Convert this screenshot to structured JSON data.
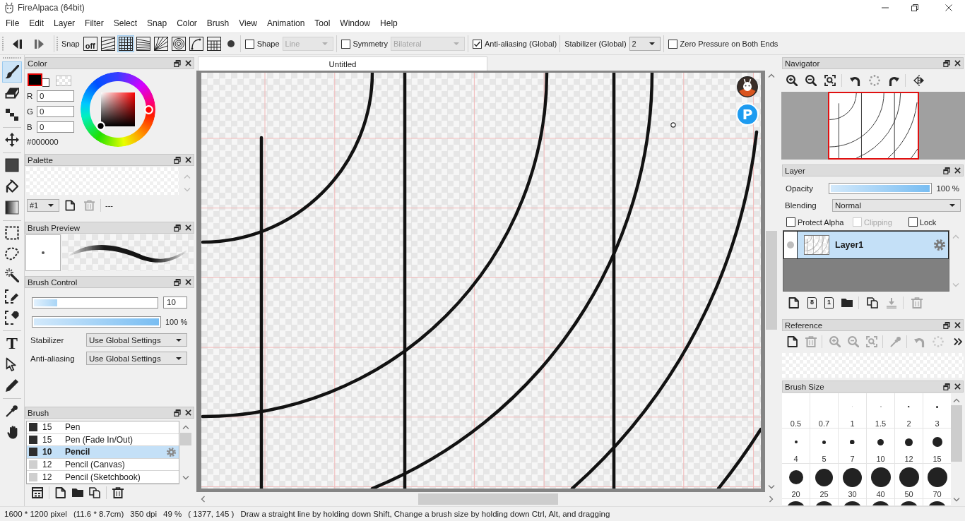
{
  "window": {
    "title": "FireAlpaca (64bit)"
  },
  "menu": [
    "File",
    "Edit",
    "Layer",
    "Filter",
    "Select",
    "Snap",
    "Color",
    "Brush",
    "View",
    "Animation",
    "Tool",
    "Window",
    "Help"
  ],
  "toolbar": {
    "snap_label": "Snap",
    "snap_modes": [
      {
        "kind": "off",
        "label": "off",
        "selected": false
      },
      {
        "kind": "parallel",
        "selected": false
      },
      {
        "kind": "grid",
        "selected": true
      },
      {
        "kind": "converging",
        "selected": false
      },
      {
        "kind": "radial",
        "selected": false
      },
      {
        "kind": "concentric",
        "selected": false
      },
      {
        "kind": "curve",
        "selected": false
      },
      {
        "kind": "perspective",
        "selected": false
      }
    ],
    "options": [
      {
        "kind": "checkbox-dropdown",
        "label": "Shape",
        "checked": false,
        "value": "Line",
        "disabled": true
      },
      {
        "kind": "checkbox-dropdown",
        "label": "Symmetry",
        "checked": false,
        "value": "Bilateral",
        "disabled": true
      },
      {
        "kind": "checkbox",
        "label": "Anti-aliasing (Global)",
        "checked": true
      },
      {
        "kind": "dropdown",
        "label": "Stabilizer (Global)",
        "value": "2"
      },
      {
        "kind": "checkbox",
        "label": "Zero Pressure on Both Ends",
        "checked": false
      }
    ]
  },
  "tool_groups": [
    [
      {
        "kind": "brush",
        "selected": true
      },
      {
        "kind": "eraser",
        "selected": false
      },
      {
        "kind": "dot",
        "selected": false
      }
    ],
    [
      {
        "kind": "move",
        "selected": false
      }
    ],
    [
      {
        "kind": "fill",
        "selected": false
      },
      {
        "kind": "bucket",
        "selected": false
      },
      {
        "kind": "gradient",
        "selected": false
      }
    ],
    [
      {
        "kind": "select",
        "selected": false
      },
      {
        "kind": "lasso",
        "selected": false
      },
      {
        "kind": "wand",
        "selected": false
      },
      {
        "kind": "select-pen",
        "selected": false
      },
      {
        "kind": "select-eraser",
        "selected": false
      }
    ],
    [
      {
        "kind": "text",
        "label": "T",
        "selected": false
      },
      {
        "kind": "pointer",
        "selected": false
      },
      {
        "kind": "pen",
        "selected": false
      }
    ],
    [
      {
        "kind": "eyedropper",
        "selected": false
      },
      {
        "kind": "hand",
        "selected": false
      }
    ]
  ],
  "color_panel": {
    "title": "Color",
    "swatches": [
      {
        "kind": "foreground",
        "color": "#000000",
        "selected": true
      },
      {
        "kind": "background",
        "color": "#ffffff",
        "selected": false
      },
      {
        "kind": "transparent",
        "selected": false
      }
    ],
    "channels": [
      {
        "label": "R",
        "value": "0"
      },
      {
        "label": "G",
        "value": "0"
      },
      {
        "label": "B",
        "value": "0"
      }
    ],
    "hex": "#000000"
  },
  "palette_panel": {
    "title": "Palette",
    "palette_set": "#1",
    "buttons": [
      {
        "kind": "new",
        "disabled": false
      },
      {
        "kind": "delete",
        "disabled": true
      }
    ],
    "palette_name": "---"
  },
  "brush_preview_panel": {
    "title": "Brush Preview"
  },
  "brush_control_panel": {
    "title": "Brush Control",
    "size": {
      "level": 0.19,
      "value": "10"
    },
    "opacity": {
      "level": 1,
      "reading": "100 %"
    },
    "settings": [
      {
        "label": "Stabilizer",
        "value": "Use Global Settings"
      },
      {
        "label": "Anti-aliasing",
        "value": "Use Global Settings"
      }
    ]
  },
  "brush_panel": {
    "title": "Brush",
    "brushes": [
      {
        "size": "15",
        "name": "Pen",
        "color": "#2e2e2e",
        "selected": false
      },
      {
        "size": "15",
        "name": "Pen (Fade In/Out)",
        "color": "#2e2e2e",
        "selected": false
      },
      {
        "size": "10",
        "name": "Pencil",
        "color": "#2e2e2e",
        "selected": true
      },
      {
        "size": "12",
        "name": "Pencil (Canvas)",
        "color": "#cfcfcf",
        "selected": false
      },
      {
        "size": "12",
        "name": "Pencil (Sketchbook)",
        "color": "#cfcfcf",
        "selected": false
      }
    ],
    "buttons": [
      [
        {
          "kind": "brush-set",
          "disabled": false
        }
      ],
      [
        {
          "kind": "new",
          "disabled": false
        },
        {
          "kind": "folder",
          "disabled": false
        },
        {
          "kind": "duplicate",
          "disabled": false
        }
      ],
      [
        {
          "kind": "delete",
          "disabled": false
        }
      ]
    ]
  },
  "document_tabs": [
    {
      "label": "Untitled",
      "selected": true
    }
  ],
  "canvas": {
    "badges": [
      {
        "kind": "mascot"
      },
      {
        "kind": "letter",
        "label": "P"
      }
    ]
  },
  "navigator_panel": {
    "title": "Navigator",
    "buttons": [
      [
        {
          "kind": "zoom-in",
          "disabled": false
        },
        {
          "kind": "zoom-out",
          "disabled": false
        },
        {
          "kind": "zoom-fit",
          "disabled": false
        }
      ],
      [
        {
          "kind": "rotate-left",
          "disabled": false
        },
        {
          "kind": "rotate-reset",
          "disabled": false
        },
        {
          "kind": "rotate-right",
          "disabled": false
        }
      ],
      [
        {
          "kind": "flip",
          "disabled": false
        }
      ]
    ]
  },
  "layer_panel": {
    "title": "Layer",
    "opacity": {
      "label": "Opacity",
      "level": 1,
      "reading": "100 %"
    },
    "blending": {
      "label": "Blending",
      "value": "Normal"
    },
    "options": [
      {
        "label": "Protect Alpha",
        "checked": false,
        "disabled": false
      },
      {
        "label": "Clipping",
        "checked": false,
        "disabled": true
      },
      {
        "label": "Lock",
        "checked": false,
        "disabled": false
      }
    ],
    "layers": [
      {
        "name": "Layer1",
        "selected": true
      }
    ],
    "buttons": [
      [
        {
          "kind": "new",
          "disabled": false
        },
        {
          "kind": "new-8bit",
          "label": "8",
          "disabled": false
        },
        {
          "kind": "new-1bit",
          "label": "1",
          "disabled": false
        },
        {
          "kind": "folder",
          "disabled": false
        }
      ],
      [
        {
          "kind": "duplicate",
          "disabled": false
        },
        {
          "kind": "merge-down",
          "disabled": true
        }
      ],
      [
        {
          "kind": "delete",
          "disabled": true
        }
      ]
    ]
  },
  "reference_panel": {
    "title": "Reference",
    "buttons": [
      [
        {
          "kind": "new",
          "disabled": false
        },
        {
          "kind": "delete",
          "disabled": true
        }
      ],
      [
        {
          "kind": "zoom-in",
          "disabled": true
        },
        {
          "kind": "zoom-out",
          "disabled": true
        },
        {
          "kind": "zoom-fit",
          "disabled": true
        }
      ],
      [
        {
          "kind": "eyedropper",
          "disabled": true
        }
      ],
      [
        {
          "kind": "rotate-left",
          "disabled": true
        },
        {
          "kind": "rotate-reset",
          "disabled": true
        },
        {
          "kind": "more",
          "disabled": false
        }
      ]
    ]
  },
  "brush_size_panel": {
    "title": "Brush Size",
    "sizes": [
      "0.5",
      "0.7",
      "1",
      "1.5",
      "2",
      "3",
      "4",
      "5",
      "7",
      "10",
      "12",
      "15",
      "20",
      "25",
      "30",
      "40",
      "50",
      "70"
    ]
  },
  "status_bar": [
    "1600 * 1200 pixel",
    "(11.6 * 8.7cm)",
    "350 dpi",
    "49 %",
    "( 1377, 145 )",
    "Draw a straight line by holding down Shift, Change a brush size by holding down Ctrl, Alt, and dragging"
  ]
}
